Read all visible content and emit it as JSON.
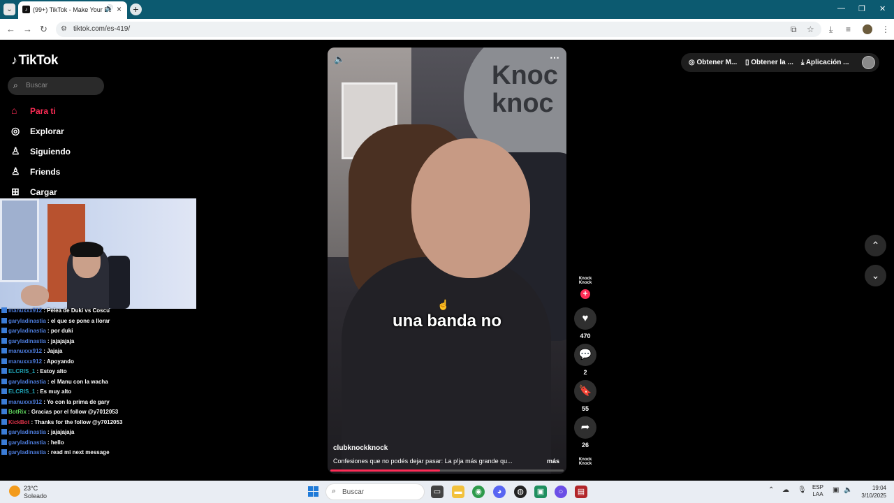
{
  "browser": {
    "tab_title": "(99+) TikTok - Make Your Day",
    "tab_title_display": "(99+) TikTok - Make Your Da",
    "url": "tiktok.com/es-419/"
  },
  "tiktok": {
    "logo_text": "TikTok",
    "search_placeholder": "Buscar",
    "nav": [
      {
        "label": "Para ti",
        "icon": "home-icon",
        "active": true
      },
      {
        "label": "Explorar",
        "icon": "compass-icon"
      },
      {
        "label": "Siguiendo",
        "icon": "following-icon"
      },
      {
        "label": "Friends",
        "icon": "friends-icon"
      },
      {
        "label": "Cargar",
        "icon": "upload-icon"
      }
    ],
    "header": {
      "get_coins": "Obtener M...",
      "get_app": "Obtener la ...",
      "desktop_app": "Aplicación ..."
    },
    "video": {
      "caption": "una banda no",
      "author": "clubknockknock",
      "description": "Confesiones que no podés dejar pasar: La p!ja más grande qu...",
      "more": "más",
      "progress": 0.47,
      "likes": "470",
      "comments": "2",
      "saves": "55",
      "shares": "26",
      "avatar_text": "Knock Knock",
      "sign_text": "Knoc knoc"
    }
  },
  "chat": [
    {
      "user": "manuxxx912",
      "msg": "Pelea de Duki vs Coscu",
      "color": "#4c7bd9"
    },
    {
      "user": "garyladinastia",
      "msg": "el que se pone a llorar",
      "color": "#4c7bd9"
    },
    {
      "user": "garyladinastia",
      "msg": "por duki",
      "color": "#4c7bd9"
    },
    {
      "user": "garyladinastia",
      "msg": "jajajajaja",
      "color": "#4c7bd9"
    },
    {
      "user": "manuxxx912",
      "msg": "Jajaja",
      "color": "#4c7bd9"
    },
    {
      "user": "manuxxx912",
      "msg": "Apoyando",
      "color": "#4c7bd9"
    },
    {
      "user": "ELCRIS_1",
      "msg": "Estoy alto",
      "color": "#20a6b8"
    },
    {
      "user": "garyladinastia",
      "msg": "el Manu con la wacha",
      "color": "#4c7bd9"
    },
    {
      "user": "ELCRIS_1",
      "msg": "Es muy alto",
      "color": "#20a6b8"
    },
    {
      "user": "manuxxx912",
      "msg": "Yo con la prima de gary",
      "color": "#4c7bd9"
    },
    {
      "user": "BotRix",
      "msg": "Gracias por el follow @y7012053",
      "color": "#5ed35c"
    },
    {
      "user": "KickBot",
      "msg": "Thanks for the follow @y7012053",
      "color": "#e0334a"
    },
    {
      "user": "garyladinastia",
      "msg": "jajajajaja",
      "color": "#4c7bd9"
    },
    {
      "user": "garyladinastia",
      "msg": "hello",
      "color": "#4c7bd9"
    },
    {
      "user": "garyladinastia",
      "msg": "read mi next message",
      "color": "#4c7bd9"
    }
  ],
  "taskbar": {
    "temperature": "23°C",
    "condition": "Soleado",
    "search_placeholder": "Buscar",
    "lang_line1": "ESP",
    "lang_line2": "LAA",
    "time": "19:04",
    "date": "3/10/2025"
  }
}
